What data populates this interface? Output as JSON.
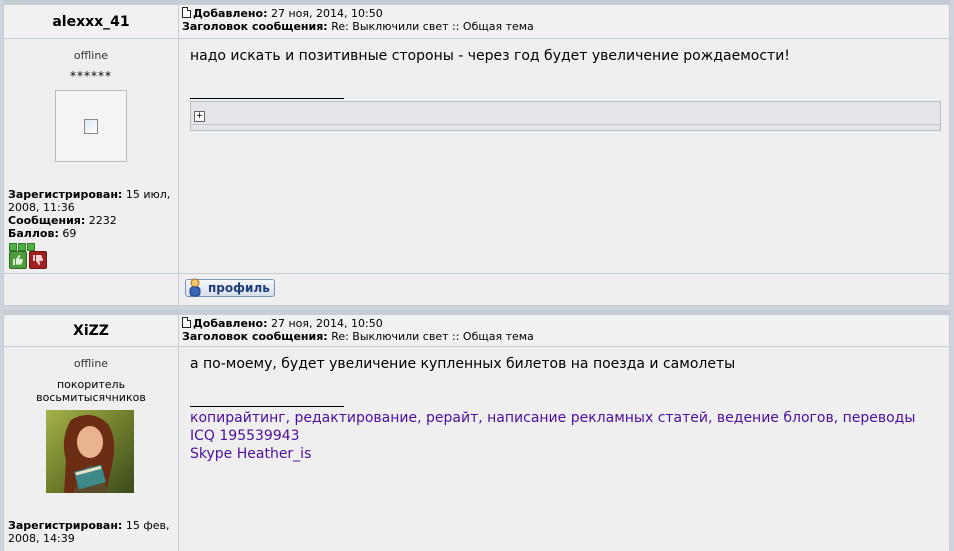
{
  "posts": [
    {
      "author": "alexxx_41",
      "meta": {
        "added_label": "Добавлено:",
        "added_value": "27 ноя, 2014, 10:50",
        "subject_label": "Заголовок сообщения:",
        "subject_value": "Re: Выключили свет :: Общая тема"
      },
      "status": "offline",
      "stars": "******",
      "stats": {
        "registered_label": "Зарегистрирован:",
        "registered_value": "15 июл, 2008, 11:36",
        "messages_label": "Сообщения:",
        "messages_value": "2232",
        "points_label": "Баллов:",
        "points_value": "69"
      },
      "message": "надо искать и позитивные стороны - через год будет увеличение рождаемости!",
      "profile_button": "профиль"
    },
    {
      "author": "XiZZ",
      "meta": {
        "added_label": "Добавлено:",
        "added_value": "27 ноя, 2014, 10:50",
        "subject_label": "Заголовок сообщения:",
        "subject_value": "Re: Выключили свет :: Общая тема"
      },
      "status": "offline",
      "rank_line1": "покоритель",
      "rank_line2": "восьмитысячников",
      "stats": {
        "registered_label": "Зарегистрирован:",
        "registered_value": "15 фев, 2008, 14:39"
      },
      "message": "а по-моему, будет увеличение купленных билетов на поезда и самолеты",
      "signature": [
        "копирайтинг, редактирование, рерайт, написание рекламных статей, ведение блогов, переводы",
        "ICQ 195539943",
        "Skype Heather_is"
      ]
    }
  ],
  "colors": {
    "signature_link": "#4b0f9e",
    "rating_green": "#4fb046",
    "thumb_up": "#4f9a3a",
    "thumb_down": "#a12020"
  }
}
